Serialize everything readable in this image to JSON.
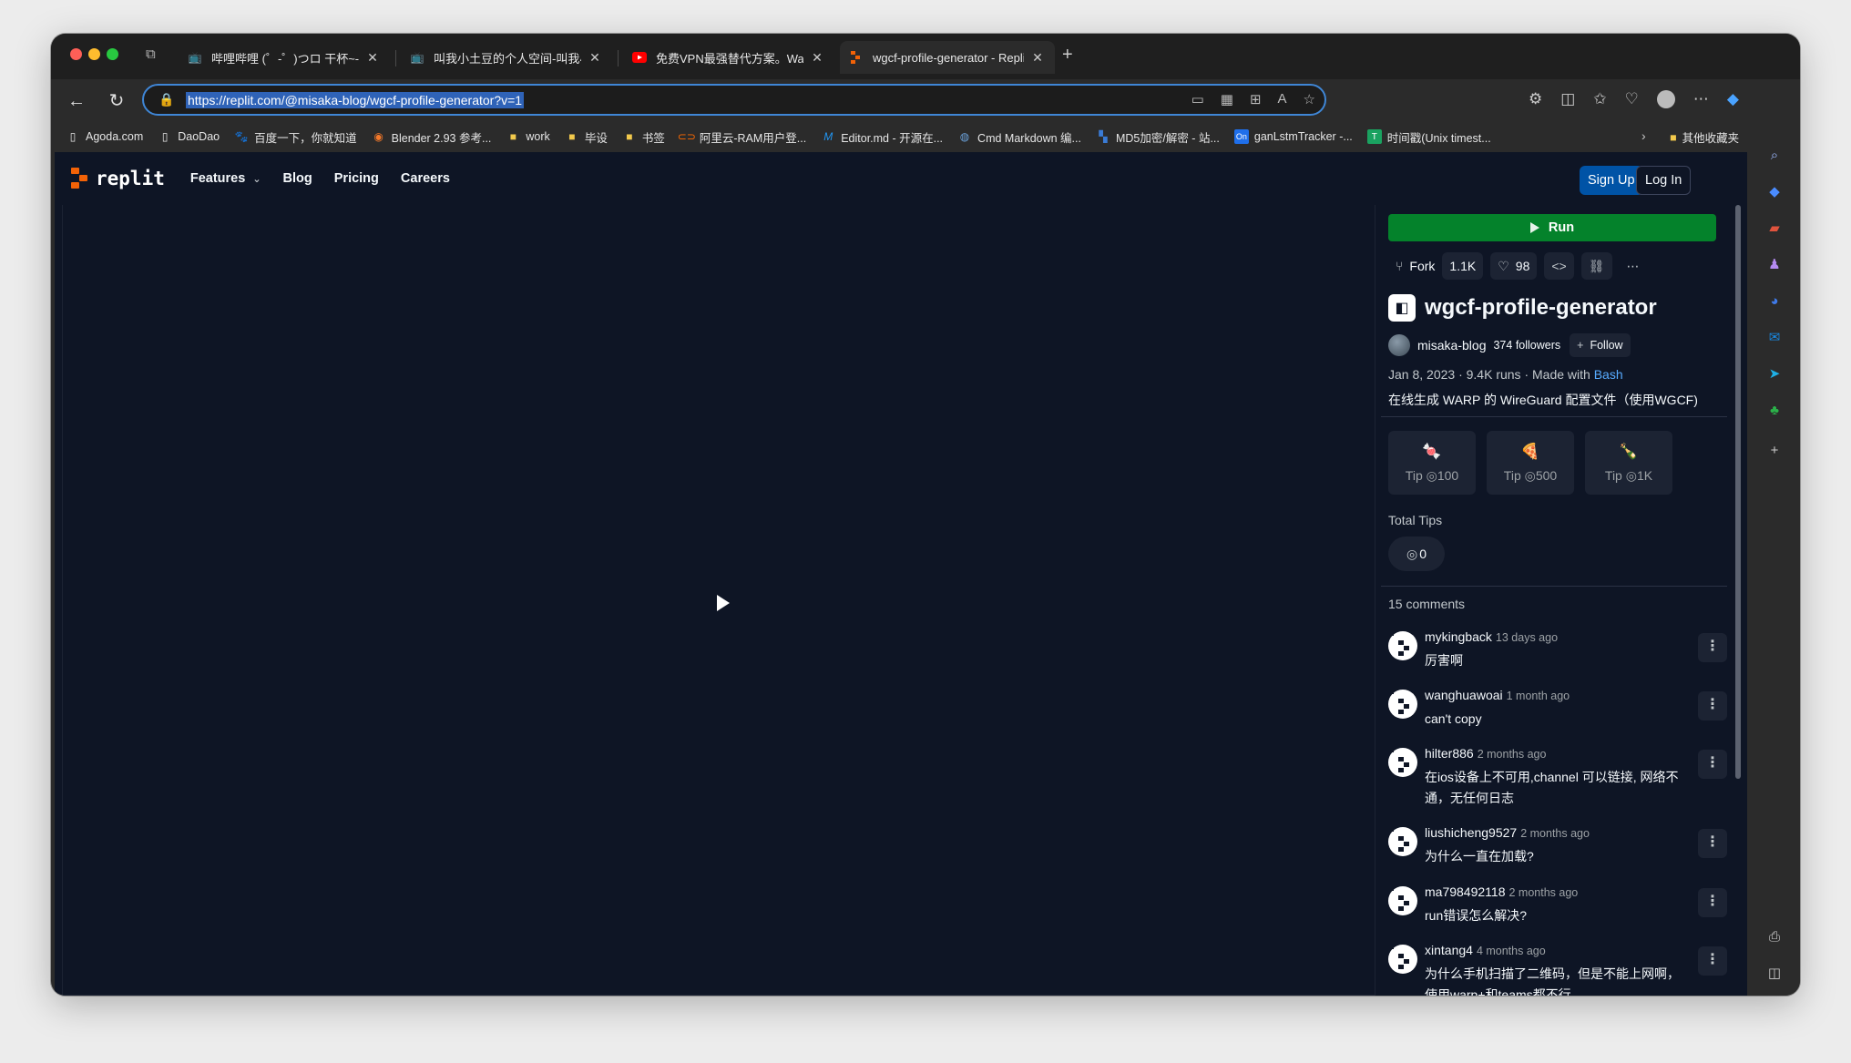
{
  "browser": {
    "tabs": [
      {
        "title": "哔哩哔哩 (゜-゜)つロ 干杯~-bili",
        "favicon": "bilibili-icon",
        "active": false
      },
      {
        "title": "叫我小土豆的个人空间-叫我小",
        "favicon": "bilibili-icon",
        "active": false
      },
      {
        "title": "免费VPN最强替代方案。Warp+",
        "favicon": "youtube-icon",
        "active": false
      },
      {
        "title": "wgcf-profile-generator - Replit",
        "favicon": "replit-icon",
        "active": true
      }
    ],
    "url": "https://replit.com/@misaka-blog/wgcf-profile-generator?v=1",
    "bookmarks": [
      {
        "label": "Agoda.com",
        "icon": "page-icon"
      },
      {
        "label": "DaoDao",
        "icon": "page-icon"
      },
      {
        "label": "百度一下，你就知道",
        "icon": "baidu-icon"
      },
      {
        "label": "Blender 2.93 参考...",
        "icon": "blender-icon"
      },
      {
        "label": "work",
        "icon": "folder-icon"
      },
      {
        "label": "毕设",
        "icon": "folder-icon"
      },
      {
        "label": "书签",
        "icon": "folder-icon"
      },
      {
        "label": "阿里云-RAM用户登...",
        "icon": "aliyun-icon"
      },
      {
        "label": "Editor.md - 开源在...",
        "icon": "editormd-icon"
      },
      {
        "label": "Cmd Markdown 编...",
        "icon": "cmd-icon"
      },
      {
        "label": "MD5加密/解密 - 站...",
        "icon": "md5-icon"
      },
      {
        "label": "ganLstmTracker -...",
        "icon": "on-icon"
      },
      {
        "label": "时间戳(Unix timest...",
        "icon": "timestamp-icon"
      }
    ],
    "other_bookmarks": "其他收藏夹"
  },
  "replit": {
    "nav": {
      "logo": "replit",
      "links": [
        "Features",
        "Blog",
        "Pricing",
        "Careers"
      ],
      "signup": "Sign Up",
      "login": "Log In"
    },
    "run_label": "Run",
    "actions": {
      "fork": "Fork",
      "fork_count": "1.1K",
      "likes": "98"
    },
    "repl_name": "wgcf-profile-generator",
    "owner": "misaka-blog",
    "followers": "374 followers",
    "follow_label": "Follow",
    "meta": {
      "date": "Jan 8, 2023",
      "runs": "9.4K runs",
      "made_with": "Made with",
      "lang": "Bash",
      "sep": "·"
    },
    "description": "在线生成 WARP 的 WireGuard 配置文件（使用WGCF)",
    "tips": [
      {
        "emoji": "🍬",
        "label": "Tip",
        "amount": "100"
      },
      {
        "emoji": "🍕",
        "label": "Tip",
        "amount": "500"
      },
      {
        "emoji": "🍾",
        "label": "Tip",
        "amount": "1K"
      }
    ],
    "total_tips_label": "Total Tips",
    "total_tips_value": "0",
    "comments_header": "15 comments",
    "comments": [
      {
        "user": "mykingback",
        "ago": "13 days ago",
        "text": "厉害啊"
      },
      {
        "user": "wanghuawoai",
        "ago": "1 month ago",
        "text": "can't copy"
      },
      {
        "user": "hilter886",
        "ago": "2 months ago",
        "text": "在ios设备上不可用,channel 可以链接, 网络不通，无任何日志"
      },
      {
        "user": "liushicheng9527",
        "ago": "2 months ago",
        "text": "为什么一直在加载?"
      },
      {
        "user": "ma798492118",
        "ago": "2 months ago",
        "text": "run错误怎么解决?"
      },
      {
        "user": "xintang4",
        "ago": "4 months ago",
        "text": "为什么手机扫描了二维码，但是不能上网啊，使用warp+和teams都不行"
      }
    ]
  }
}
